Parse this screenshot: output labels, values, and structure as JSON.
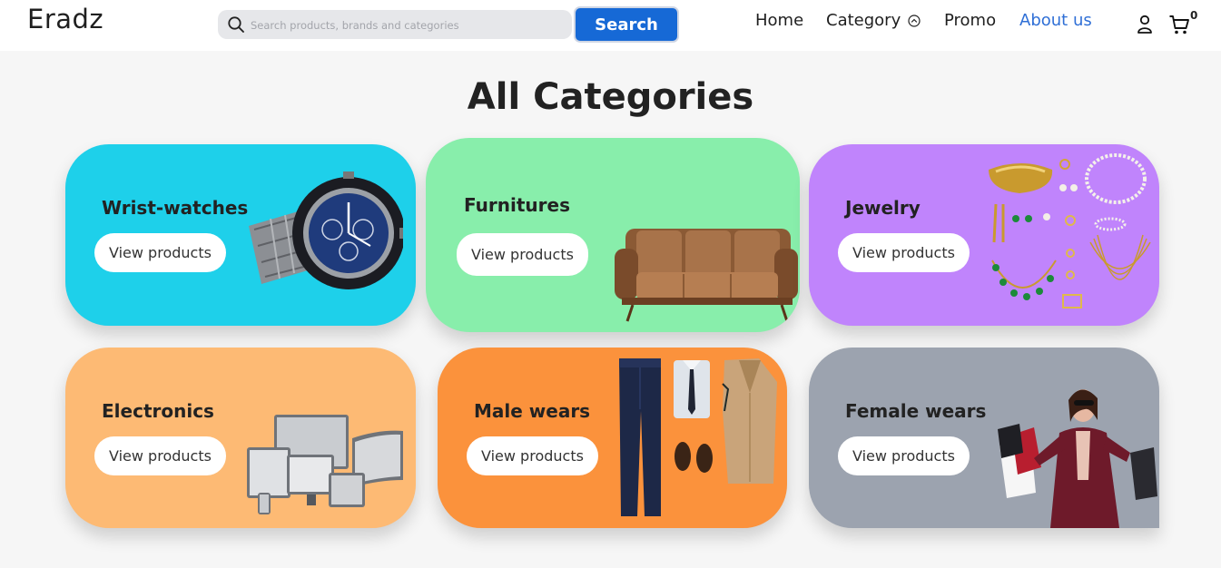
{
  "header": {
    "logo": "Eradz",
    "search": {
      "placeholder": "Search products, brands and categories",
      "button_label": "Search"
    },
    "nav": [
      {
        "label": "Home",
        "active": false
      },
      {
        "label": "Category",
        "active": false
      },
      {
        "label": "Promo",
        "active": false
      },
      {
        "label": "About us",
        "active": true
      }
    ],
    "cart_count": "0"
  },
  "page_title": "All Categories",
  "categories": [
    {
      "title": "Wrist-watches",
      "button_label": "View products",
      "color": "#1ed0ea"
    },
    {
      "title": "Furnitures",
      "button_label": "View products",
      "color": "#88eeab"
    },
    {
      "title": "Jewelry",
      "button_label": "View products",
      "color": "#c084fc"
    },
    {
      "title": "Electronics",
      "button_label": "View products",
      "color": "#fdba74"
    },
    {
      "title": "Male wears",
      "button_label": "View products",
      "color": "#fb923c"
    },
    {
      "title": "Female wears",
      "button_label": "View products",
      "color": "#9ca3af"
    }
  ],
  "icons": [
    "search-icon",
    "chevron-circle-icon",
    "user-icon",
    "cart-icon"
  ],
  "colors": {
    "accent": "#1669d6",
    "active_nav": "#2f6fd6"
  }
}
